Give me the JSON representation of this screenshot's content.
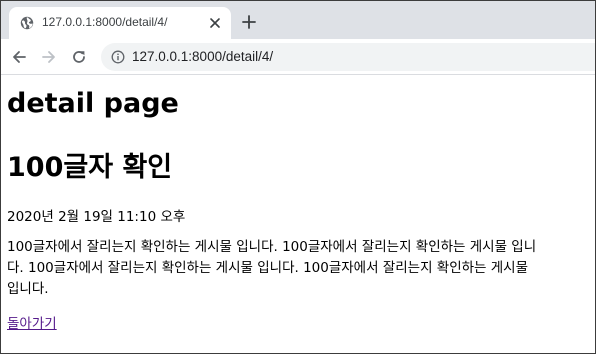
{
  "browser": {
    "tab": {
      "title": "127.0.0.1:8000/detail/4/"
    },
    "address_bar": {
      "url": "127.0.0.1:8000/detail/4/"
    },
    "icons": {
      "favicon": "globe-icon",
      "close": "close-icon",
      "new_tab": "plus-icon",
      "back": "arrow-left-icon",
      "forward": "arrow-right-icon",
      "reload": "reload-icon",
      "info": "info-icon"
    }
  },
  "page": {
    "heading": "detail page",
    "post_title": "100글자 확인",
    "date": "2020년 2월 19일 11:10 오후",
    "body_lines": [
      "100글자에서 잘리는지 확인하는 게시물 입니다. 100글자에서 잘리는지 확인하는 게시물 입니",
      "다. 100글자에서 잘리는지 확인하는 게시물 입니다. 100글자에서 잘리는지 확인하는 게시물",
      "입니다."
    ],
    "back_link": "돌아가기"
  },
  "colors": {
    "tabstrip": "#dee1e6",
    "omnibox": "#f1f3f4",
    "visited_link": "#551a8b"
  }
}
